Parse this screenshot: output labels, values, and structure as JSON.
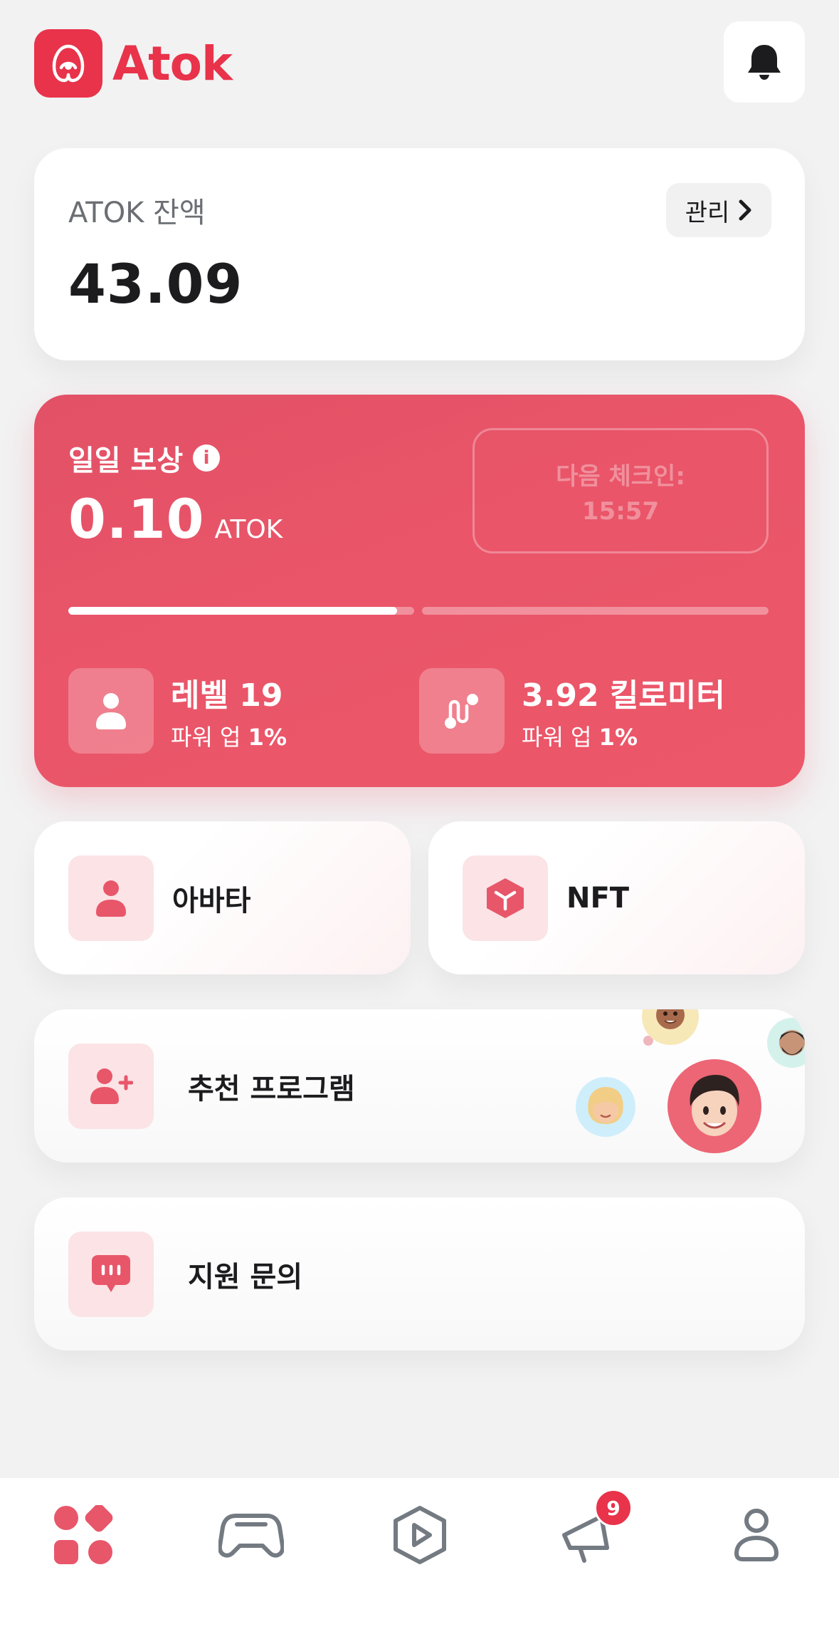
{
  "app": {
    "brand": "Atok",
    "accent": "#e8334a"
  },
  "header": {
    "notifications_icon": "bell-icon"
  },
  "balance": {
    "label": "ATOK 잔액",
    "value": "43.09",
    "manage_label": "관리"
  },
  "reward": {
    "title": "일일 보상",
    "value": "0.10",
    "unit": "ATOK",
    "checkin_label": "다음 체크인:",
    "checkin_time": "15:57",
    "progress_segment_1": 0.95,
    "progress_segment_2": 0.0,
    "level": {
      "label": "레벨 19",
      "sub_prefix": "파워 업",
      "sub_value": "1%"
    },
    "distance": {
      "label": "3.92 킬로미터",
      "sub_prefix": "파워 업",
      "sub_value": "1%"
    }
  },
  "tiles": {
    "avatar": "아바타",
    "nft": "NFT"
  },
  "menu": {
    "referral": "추천 프로그램",
    "support": "지원 문의"
  },
  "tabbar": {
    "tabs": [
      "home-icon",
      "gamepad-icon",
      "play-icon",
      "megaphone-icon",
      "profile-icon"
    ],
    "notification_count": "9"
  }
}
